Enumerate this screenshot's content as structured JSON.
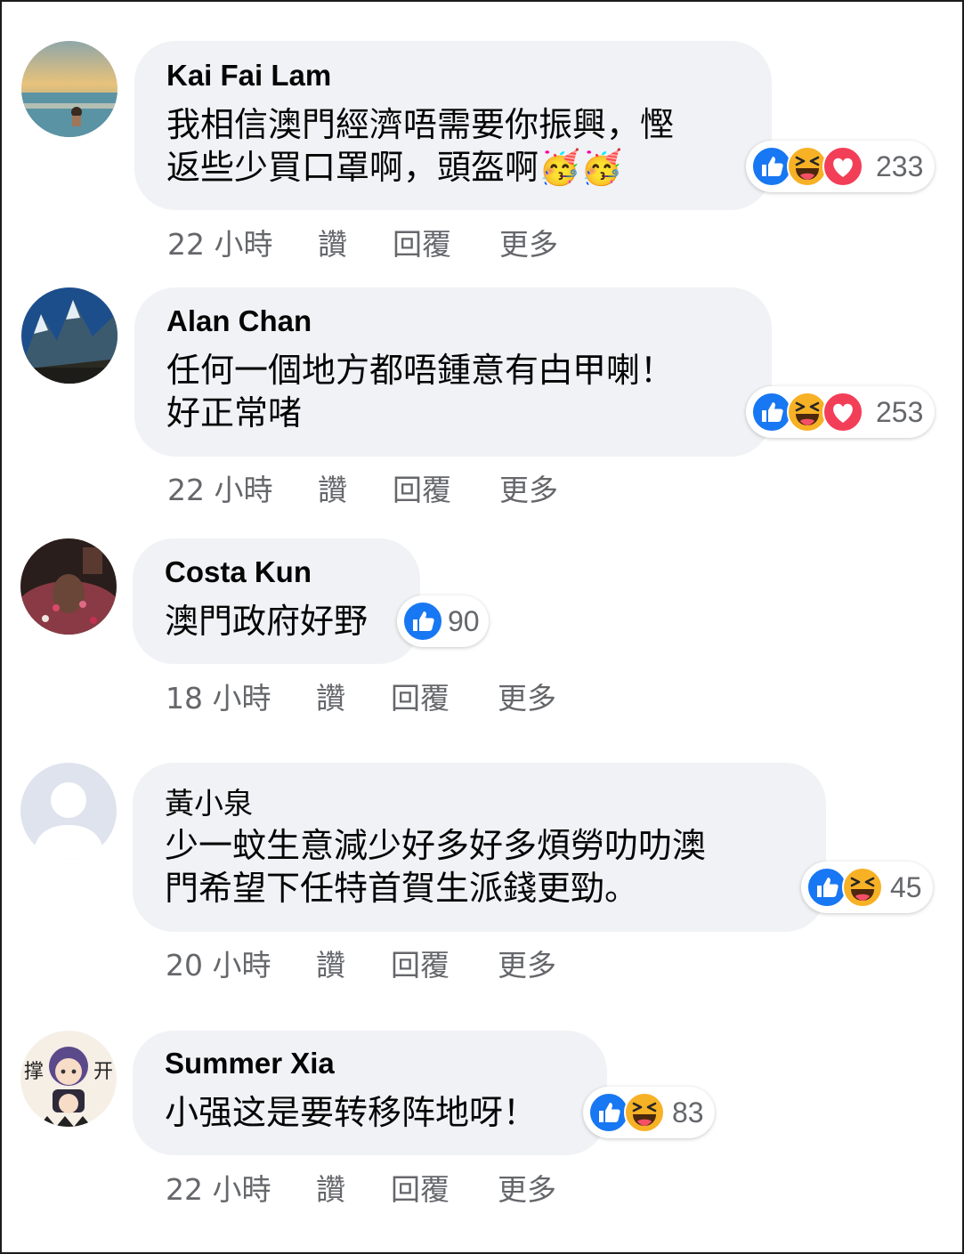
{
  "colors": {
    "bubble": "#f0f2f5",
    "meta_text": "#65676b",
    "like_blue": "#1877f2",
    "haha_yellow": "#f7b125",
    "love_red": "#f33e58"
  },
  "actions": {
    "like": "讚",
    "reply": "回覆",
    "more": "更多"
  },
  "comments": [
    {
      "author": "Kai Fai Lam",
      "lines": [
        "我相信澳門經濟唔需要你振興，慳",
        "返些少買口罩啊，頭盔啊🥳🥳"
      ],
      "time": "22 小時",
      "reactions": [
        "like-icon",
        "haha-icon",
        "love-icon"
      ],
      "count": "233"
    },
    {
      "author": "Alan Chan",
      "lines": [
        "任何一個地方都唔鍾意有甴甲喇！",
        "好正常啫"
      ],
      "time": "22 小時",
      "reactions": [
        "like-icon",
        "haha-icon",
        "love-icon"
      ],
      "count": "253"
    },
    {
      "author": "Costa Kun",
      "lines": [
        "澳門政府好野"
      ],
      "time": "18 小時",
      "reactions": [
        "like-icon"
      ],
      "count": "90"
    },
    {
      "author": "黃小泉",
      "lines": [
        "少一蚊生意減少好多好多煩勞叻叻澳",
        "門希望下任特首賀生派錢更勁。"
      ],
      "time": "20 小時",
      "reactions": [
        "like-icon",
        "haha-icon"
      ],
      "count": "45"
    },
    {
      "author": "Summer Xia",
      "lines": [
        "小强这是要转移阵地呀！"
      ],
      "time": "22 小時",
      "reactions": [
        "like-icon",
        "haha-icon"
      ],
      "count": "83"
    }
  ],
  "avatar_texts": {
    "left": "撑",
    "right": "开"
  }
}
